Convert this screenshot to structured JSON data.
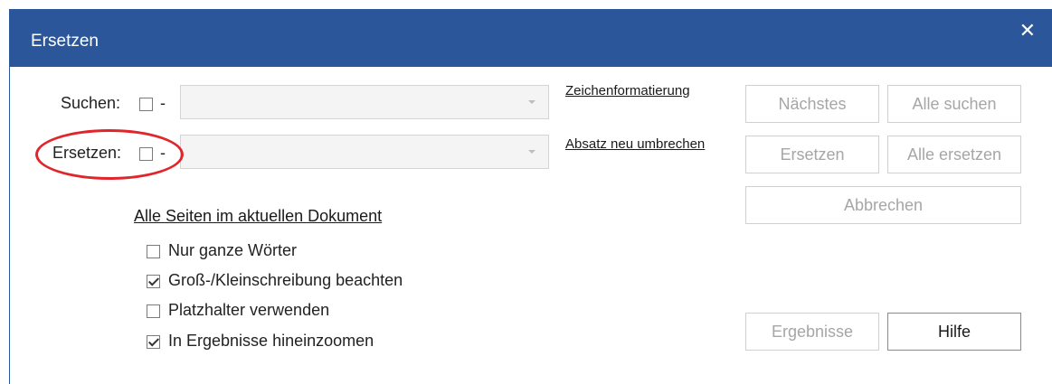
{
  "window": {
    "title": "Ersetzen",
    "close_glyph": "✕"
  },
  "search": {
    "label": "Suchen:",
    "dash": "-",
    "value": "",
    "checkbox_checked": false
  },
  "replace": {
    "label": "Ersetzen:",
    "dash": "-",
    "value": "",
    "checkbox_checked": false
  },
  "links": {
    "char_format": "Zeichenformatierung",
    "paragraph_break": "Absatz neu umbrechen",
    "scope": "Alle Seiten im aktuellen Dokument"
  },
  "buttons": {
    "next": "Nächstes",
    "find_all": "Alle suchen",
    "replace": "Ersetzen",
    "replace_all": "Alle ersetzen",
    "cancel": "Abbrechen",
    "results": "Ergebnisse",
    "help": "Hilfe"
  },
  "options": [
    {
      "label": "Nur ganze Wörter",
      "checked": false
    },
    {
      "label": "Groß-/Kleinschreibung beachten",
      "checked": true
    },
    {
      "label": "Platzhalter verwenden",
      "checked": false
    },
    {
      "label": "In Ergebnisse hineinzoomen",
      "checked": true
    }
  ],
  "colors": {
    "titlebar": "#2b579a",
    "highlight": "#e0262b",
    "disabled_text": "#a6a6a6"
  }
}
